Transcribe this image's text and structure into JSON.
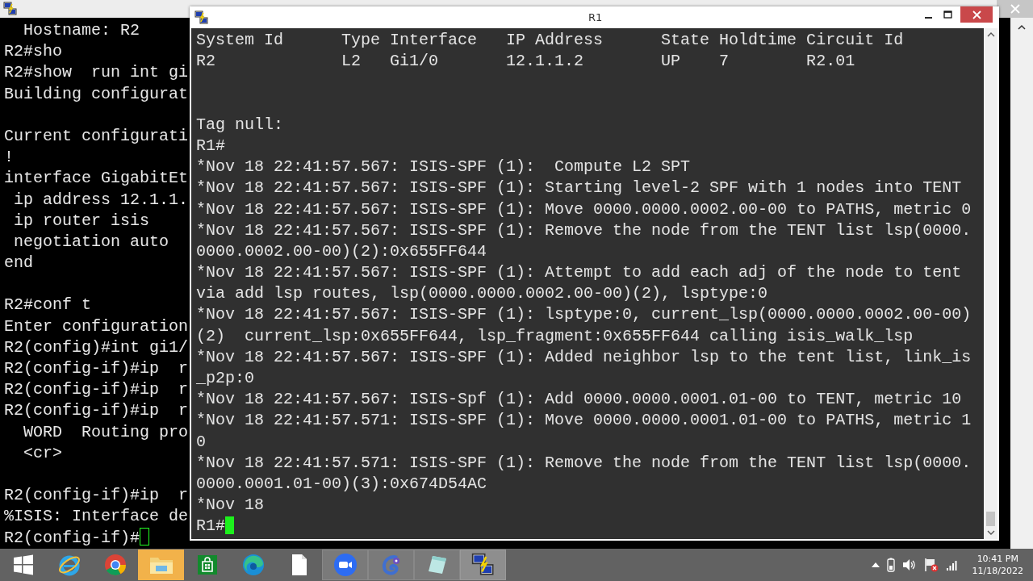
{
  "background_window": {
    "blocks": [
      [
        "  Hostname: R2",
        "R2#sho",
        "R2#show  run int gi",
        "Building configurat"
      ],
      [
        "Current configurati",
        "!",
        "interface GigabitEt",
        " ip address 12.1.1.",
        " ip router isis",
        " negotiation auto",
        "end"
      ],
      [
        "R2#conf t",
        "Enter configuration",
        "R2(config)#int gi1/",
        "R2(config-if)#ip  r",
        "R2(config-if)#ip  r",
        "R2(config-if)#ip  r",
        "  WORD  Routing pro",
        "  <cr>"
      ],
      [
        "R2(config-if)#ip  r",
        "%ISIS: Interface de",
        "R2(config-if)#"
      ]
    ]
  },
  "window": {
    "title": "R1",
    "neighbors": [
      "System Id      Type Interface   IP Address      State Holdtime Circuit Id",
      "R2             L2   Gi1/0       12.1.1.2        UP    7        R2.01"
    ],
    "log": [
      "Tag null:",
      "R1#",
      "*Nov 18 22:41:57.567: ISIS-SPF (1):  Compute L2 SPT",
      "*Nov 18 22:41:57.567: ISIS-SPF (1): Starting level-2 SPF with 1 nodes into TENT",
      "*Nov 18 22:41:57.567: ISIS-SPF (1): Move 0000.0000.0002.00-00 to PATHS, metric 0",
      "*Nov 18 22:41:57.567: ISIS-SPF (1): Remove the node from the TENT list lsp(0000.",
      "0000.0002.00-00)(2):0x655FF644",
      "*Nov 18 22:41:57.567: ISIS-SPF (1): Attempt to add each adj of the node to tent",
      "via add lsp routes, lsp(0000.0000.0002.00-00)(2), lsptype:0",
      "*Nov 18 22:41:57.567: ISIS-SPF (1): lsptype:0, current_lsp(0000.0000.0002.00-00)",
      "(2)  current_lsp:0x655FF644, lsp_fragment:0x655FF644 calling isis_walk_lsp",
      "*Nov 18 22:41:57.567: ISIS-SPF (1): Added neighbor lsp to the tent list, link_is",
      "_p2p:0",
      "*Nov 18 22:41:57.567: ISIS-Spf (1): Add 0000.0000.0001.01-00 to TENT, metric 10",
      "*Nov 18 22:41:57.571: ISIS-SPF (1): Move 0000.0000.0001.01-00 to PATHS, metric 1",
      "0",
      "*Nov 18 22:41:57.571: ISIS-SPF (1): Remove the node from the TENT list lsp(0000.",
      "0000.0001.01-00)(3):0x674D54AC",
      "*Nov 18",
      "R1#"
    ]
  },
  "taskbar": {
    "apps": [
      {
        "kind": "start",
        "running": false,
        "selected": false,
        "attention": false
      },
      {
        "kind": "ie",
        "running": false,
        "selected": false,
        "attention": false
      },
      {
        "kind": "chrome",
        "running": false,
        "selected": false,
        "attention": false
      },
      {
        "kind": "folder",
        "running": false,
        "selected": false,
        "attention": true
      },
      {
        "kind": "store",
        "running": false,
        "selected": false,
        "attention": false
      },
      {
        "kind": "edge",
        "running": false,
        "selected": false,
        "attention": false
      },
      {
        "kind": "file",
        "running": false,
        "selected": false,
        "attention": false
      },
      {
        "kind": "video",
        "running": true,
        "selected": false,
        "attention": false
      },
      {
        "kind": "chameleon",
        "running": true,
        "selected": false,
        "attention": false
      },
      {
        "kind": "notepad",
        "running": true,
        "selected": false,
        "attention": false
      },
      {
        "kind": "putty",
        "running": true,
        "selected": true,
        "attention": false
      }
    ],
    "time": "10:41 PM",
    "date": "11/18/2022"
  }
}
